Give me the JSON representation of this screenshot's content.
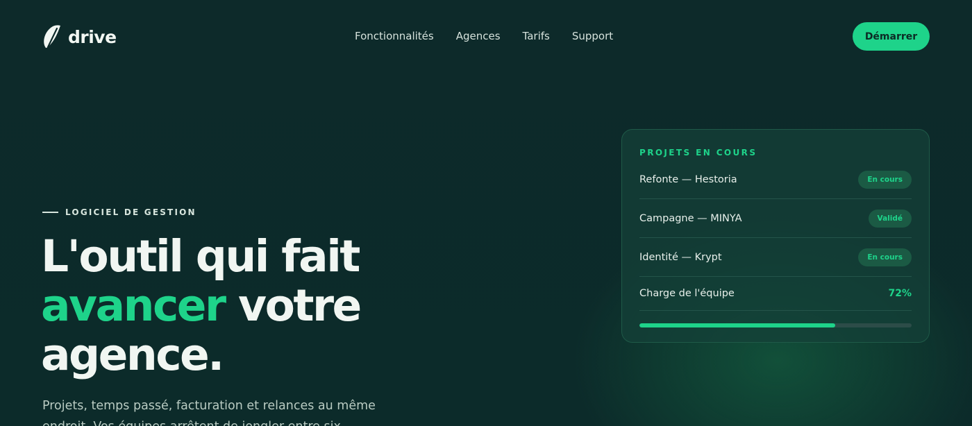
{
  "brand": {
    "name": "drive"
  },
  "nav": {
    "items": [
      {
        "label": "Fonctionnalités"
      },
      {
        "label": "Agences"
      },
      {
        "label": "Tarifs"
      },
      {
        "label": "Support"
      }
    ],
    "cta_label": "Démarrer"
  },
  "hero": {
    "eyebrow": "LOGICIEL DE GESTION",
    "headline_line1": "L'outil qui fait",
    "headline_accent": "avancer",
    "headline_rest": " votre",
    "headline_line3": "agence.",
    "lede": "Projets, temps passé, facturation et relances au même endroit. Vos équipes arrêtent de jongler entre six"
  },
  "card": {
    "title": "PROJETS EN COURS",
    "projects": [
      {
        "name": "Refonte — Hestoria",
        "status": "En cours"
      },
      {
        "name": "Campagne — MINYA",
        "status": "Validé"
      },
      {
        "name": "Identité — Krypt",
        "status": "En cours"
      }
    ],
    "load_label": "Charge de l'équipe",
    "load_value": "72%",
    "load_fraction": 0.72
  },
  "colors": {
    "background": "#0d2a2a",
    "accent": "#1ed38a",
    "card_bg": "#14403a",
    "text": "#f1f6f2"
  }
}
